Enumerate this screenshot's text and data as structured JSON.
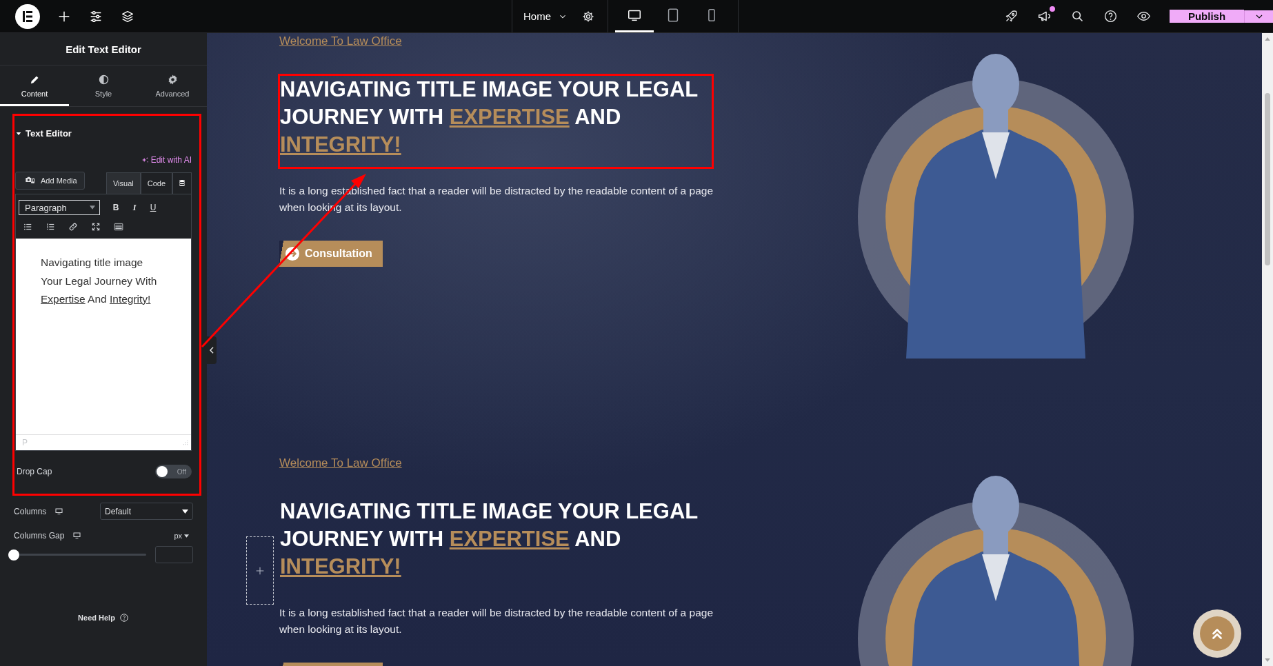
{
  "top_bar": {
    "page": "Home",
    "devices": [
      {
        "kind": "desktop",
        "selected": true
      },
      {
        "kind": "tablet",
        "selected": false
      },
      {
        "kind": "mobile",
        "selected": false
      }
    ],
    "notification_unread": true,
    "publish": "Publish"
  },
  "panel": {
    "title": "Edit Text Editor",
    "tabs": [
      {
        "kind": "content",
        "label": "Content",
        "selected": true
      },
      {
        "kind": "style",
        "label": "Style",
        "selected": false
      },
      {
        "kind": "advanced",
        "label": "Advanced",
        "selected": false
      }
    ],
    "section": {
      "title": "Text Editor",
      "expanded": true,
      "outlined": true,
      "ai_link": "Edit with AI",
      "add_media": "Add Media",
      "modes": [
        {
          "label": "Visual",
          "selected": true
        },
        {
          "label": "Code",
          "selected": false
        }
      ],
      "format": "Paragraph",
      "format_buttons": [
        {
          "kind": "bold",
          "glyph": "B"
        },
        {
          "kind": "italic",
          "glyph": "I"
        },
        {
          "kind": "underline",
          "glyph": "U"
        }
      ],
      "editor_lines": [
        [
          {
            "text": "Navigating title image",
            "underline": false
          }
        ],
        [
          {
            "text": "Your Legal Journey With ",
            "underline": false
          },
          {
            "text": "Expertise",
            "underline": true
          },
          {
            "text": " And ",
            "underline": false
          },
          {
            "text": "Integrity!",
            "underline": true
          }
        ]
      ],
      "path": "P",
      "drop_cap": {
        "label": "Drop Cap",
        "on": false,
        "state_label": "Off"
      }
    },
    "columns": {
      "label": "Columns",
      "value": "Default"
    },
    "columns_gap": {
      "label": "Columns Gap",
      "unit": "px",
      "level": 0
    },
    "help": "Need Help"
  },
  "canvas": {
    "sections": [
      {
        "eyebrow": "Welcome To Law Office",
        "outlined": true,
        "title_parts": [
          {
            "text": "NAVIGATING TITLE IMAGE YOUR LEGAL JOURNEY WITH ",
            "highlight": false
          },
          {
            "text": "EXPERTISE",
            "highlight": true
          },
          {
            "text": " AND ",
            "highlight": false
          },
          {
            "text": "INTEGRITY!",
            "highlight": true
          }
        ],
        "text": "It is a long established fact that a reader will be distracted by the readable content of a page when looking at its layout.",
        "button": "Consultation"
      },
      {
        "eyebrow": "Welcome To Law Office",
        "outlined": false,
        "title_parts": [
          {
            "text": "NAVIGATING TITLE IMAGE YOUR LEGAL JOURNEY WITH ",
            "highlight": false
          },
          {
            "text": "EXPERTISE",
            "highlight": true
          },
          {
            "text": " AND ",
            "highlight": false
          },
          {
            "text": "INTEGRITY!",
            "highlight": true
          }
        ],
        "text": "It is a long established fact that a reader will be distracted by the readable content of a page when looking at its layout."
      }
    ]
  }
}
